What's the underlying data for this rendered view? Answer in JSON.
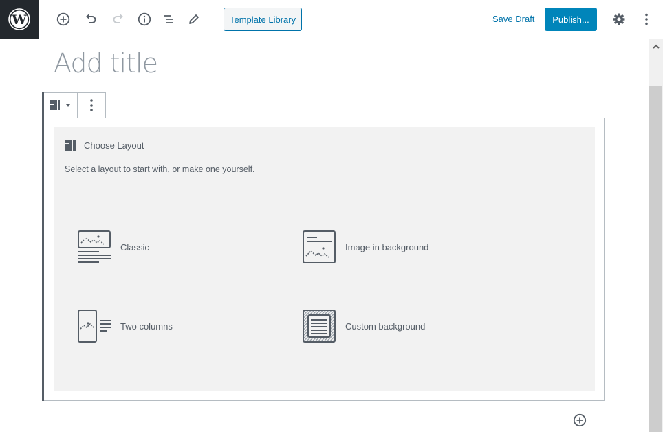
{
  "header": {
    "logo": "wordpress-logo",
    "tools": [
      {
        "name": "add-block-button",
        "icon": "plus-circle-icon"
      },
      {
        "name": "undo-button",
        "icon": "undo-icon"
      },
      {
        "name": "redo-button",
        "icon": "redo-icon",
        "disabled": true
      },
      {
        "name": "content-info-button",
        "icon": "info-icon"
      },
      {
        "name": "block-navigation-button",
        "icon": "list-icon"
      },
      {
        "name": "edit-mode-button",
        "icon": "pencil-icon"
      }
    ],
    "template_library_label": "Template Library",
    "save_draft_label": "Save Draft",
    "publish_label": "Publish...",
    "settings_icon": "gear-icon",
    "more_icon": "more-vertical-icon"
  },
  "editor": {
    "title_placeholder": "Add title",
    "block": {
      "toolbar": {
        "switcher_icon": "layout-icon",
        "more_icon": "more-vertical-icon"
      },
      "placeholder": {
        "label": "Choose Layout",
        "instructions": "Select a layout to start with, or make one yourself.",
        "options": [
          {
            "label": "Classic",
            "icon": "classic-layout-icon"
          },
          {
            "label": "Image in background",
            "icon": "image-background-layout-icon"
          },
          {
            "label": "Two columns",
            "icon": "two-columns-layout-icon"
          },
          {
            "label": "Custom background",
            "icon": "custom-background-layout-icon"
          }
        ]
      }
    },
    "inserter_icon": "plus-circle-icon"
  },
  "colors": {
    "accent": "#0085ba",
    "link": "#0073aa",
    "dark": "#23282d",
    "text": "#555d66"
  }
}
